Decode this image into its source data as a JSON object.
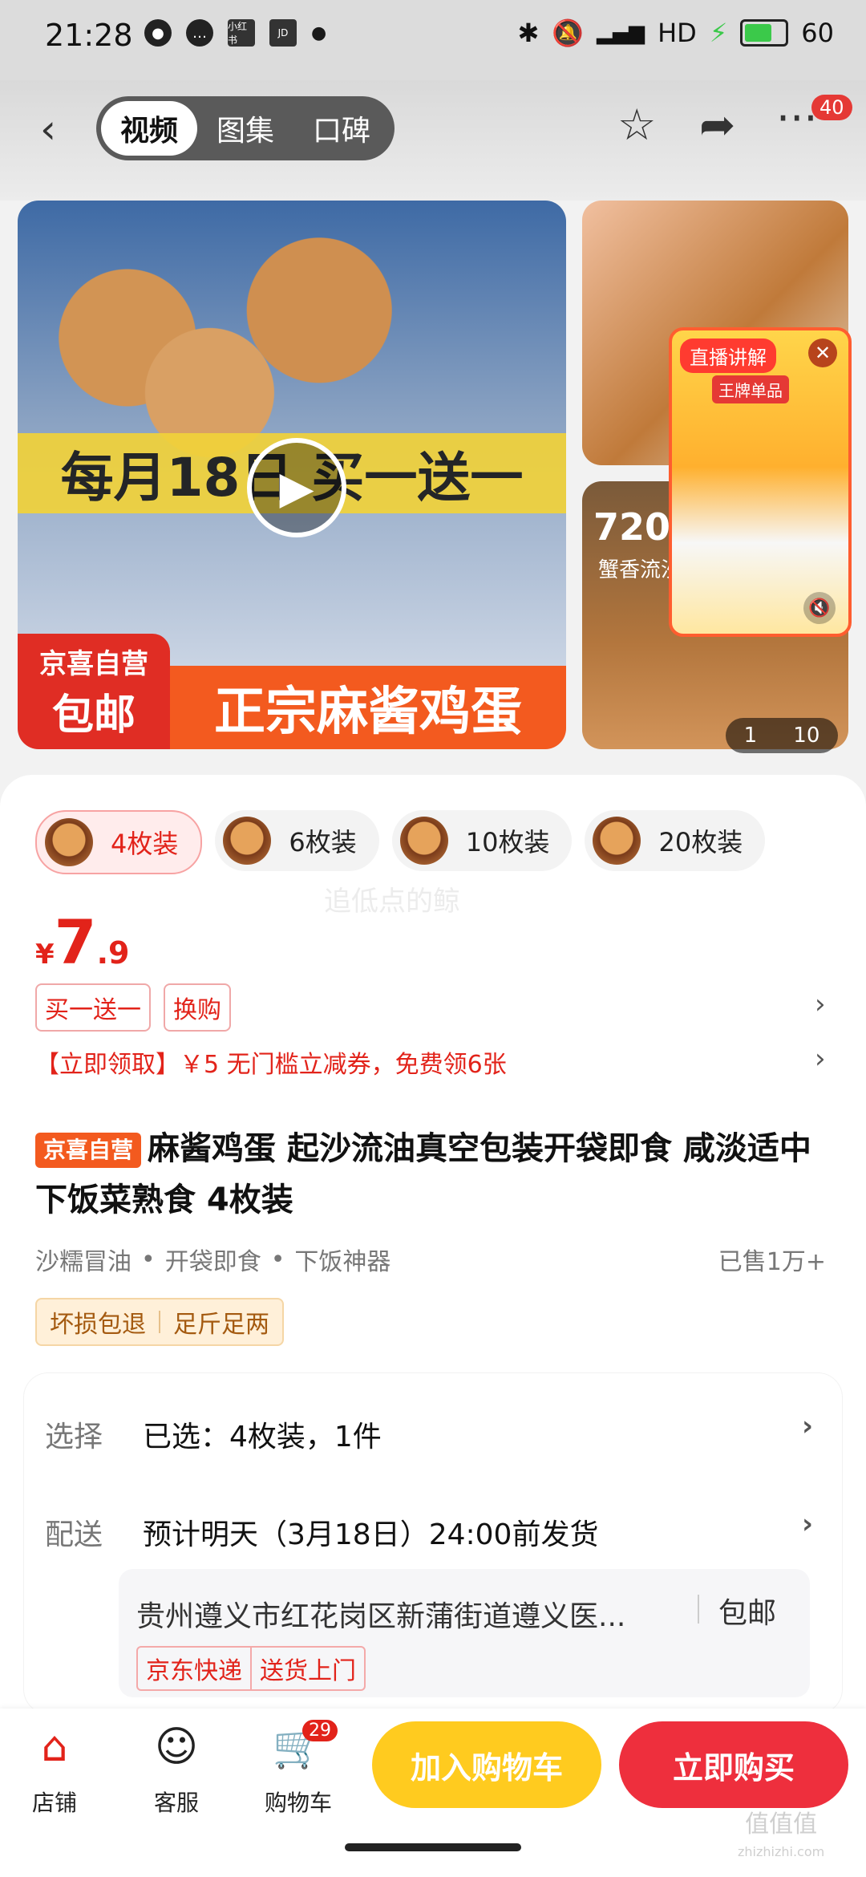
{
  "status_bar": {
    "time": "21:28",
    "left_icons": [
      "message-bubble-icon",
      "chat-icon",
      "xiaohongshu-icon",
      "jd-icon",
      "dot-icon"
    ],
    "badge_xhs": "小红书",
    "badge_jd": "JD",
    "network": "HD",
    "battery": "60"
  },
  "header": {
    "tabs": [
      "视频",
      "图集",
      "口碑"
    ],
    "active_tab": "视频",
    "more_badge": "40"
  },
  "gallery": {
    "banner_text": "每月18日 买一送一",
    "tag_line1": "京喜自营",
    "tag_line2": "包邮",
    "product_title": "正宗麻酱鸡蛋",
    "side_text": "720",
    "side_subtext": "蟹香流沙 更好",
    "counter_current": "1",
    "counter_total": "10",
    "live": {
      "label": "直播讲解",
      "title": "王牌单品"
    }
  },
  "variants": [
    {
      "label": "4枚装",
      "active": true
    },
    {
      "label": "6枚装",
      "active": false
    },
    {
      "label": "10枚装",
      "active": false
    },
    {
      "label": "20枚装",
      "active": false
    }
  ],
  "watermark": "追低点的鲸",
  "price": {
    "currency": "¥",
    "integer": "7",
    "decimal": ".9"
  },
  "promos": [
    "买一送一",
    "换购"
  ],
  "coupon": "【立即领取】￥5 无门槛立减券，免费领6张",
  "product": {
    "self_tag": "京喜自营",
    "title": "麻酱鸡蛋 起沙流油真空包装开袋即食 咸淡适中下饭菜熟食 4枚装",
    "features": [
      "沙糯冒油",
      "开袋即食",
      "下饭神器"
    ],
    "sold": "已售1万+",
    "guarantees": [
      "坏损包退",
      "足斤足两"
    ]
  },
  "info": {
    "select_label": "选择",
    "select_value": "已选：4枚装，1件",
    "delivery_label": "配送",
    "delivery_value": "预计明天（3月18日）24:00前发货",
    "address": "贵州遵义市红花岗区新蒲街道遵义医...",
    "shipping": "包邮",
    "express_tags": [
      "京东快递",
      "送货上门"
    ]
  },
  "bottom_bar": {
    "store": "店铺",
    "service": "客服",
    "cart": "购物车",
    "cart_badge": "29",
    "add_to_cart": "加入购物车",
    "buy_now": "立即购买"
  },
  "corner_watermark": {
    "main": "值值值",
    "sub": "zhizhizhi.com"
  }
}
